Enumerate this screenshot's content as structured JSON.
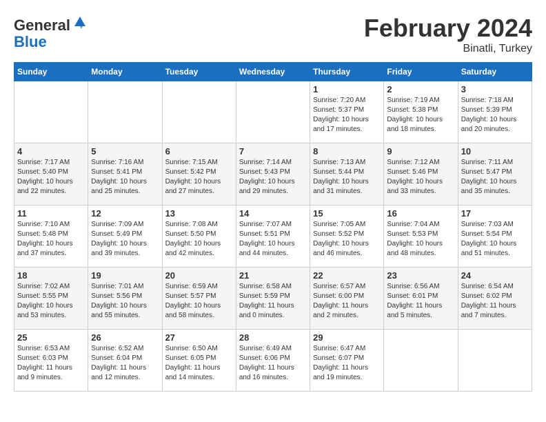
{
  "header": {
    "logo_line1": "General",
    "logo_line2": "Blue",
    "month_title": "February 2024",
    "location": "Binatli, Turkey"
  },
  "columns": [
    "Sunday",
    "Monday",
    "Tuesday",
    "Wednesday",
    "Thursday",
    "Friday",
    "Saturday"
  ],
  "weeks": [
    [
      {
        "day": "",
        "sunrise": "",
        "sunset": "",
        "daylight": ""
      },
      {
        "day": "",
        "sunrise": "",
        "sunset": "",
        "daylight": ""
      },
      {
        "day": "",
        "sunrise": "",
        "sunset": "",
        "daylight": ""
      },
      {
        "day": "",
        "sunrise": "",
        "sunset": "",
        "daylight": ""
      },
      {
        "day": "1",
        "sunrise": "Sunrise: 7:20 AM",
        "sunset": "Sunset: 5:37 PM",
        "daylight": "Daylight: 10 hours and 17 minutes."
      },
      {
        "day": "2",
        "sunrise": "Sunrise: 7:19 AM",
        "sunset": "Sunset: 5:38 PM",
        "daylight": "Daylight: 10 hours and 18 minutes."
      },
      {
        "day": "3",
        "sunrise": "Sunrise: 7:18 AM",
        "sunset": "Sunset: 5:39 PM",
        "daylight": "Daylight: 10 hours and 20 minutes."
      }
    ],
    [
      {
        "day": "4",
        "sunrise": "Sunrise: 7:17 AM",
        "sunset": "Sunset: 5:40 PM",
        "daylight": "Daylight: 10 hours and 22 minutes."
      },
      {
        "day": "5",
        "sunrise": "Sunrise: 7:16 AM",
        "sunset": "Sunset: 5:41 PM",
        "daylight": "Daylight: 10 hours and 25 minutes."
      },
      {
        "day": "6",
        "sunrise": "Sunrise: 7:15 AM",
        "sunset": "Sunset: 5:42 PM",
        "daylight": "Daylight: 10 hours and 27 minutes."
      },
      {
        "day": "7",
        "sunrise": "Sunrise: 7:14 AM",
        "sunset": "Sunset: 5:43 PM",
        "daylight": "Daylight: 10 hours and 29 minutes."
      },
      {
        "day": "8",
        "sunrise": "Sunrise: 7:13 AM",
        "sunset": "Sunset: 5:44 PM",
        "daylight": "Daylight: 10 hours and 31 minutes."
      },
      {
        "day": "9",
        "sunrise": "Sunrise: 7:12 AM",
        "sunset": "Sunset: 5:46 PM",
        "daylight": "Daylight: 10 hours and 33 minutes."
      },
      {
        "day": "10",
        "sunrise": "Sunrise: 7:11 AM",
        "sunset": "Sunset: 5:47 PM",
        "daylight": "Daylight: 10 hours and 35 minutes."
      }
    ],
    [
      {
        "day": "11",
        "sunrise": "Sunrise: 7:10 AM",
        "sunset": "Sunset: 5:48 PM",
        "daylight": "Daylight: 10 hours and 37 minutes."
      },
      {
        "day": "12",
        "sunrise": "Sunrise: 7:09 AM",
        "sunset": "Sunset: 5:49 PM",
        "daylight": "Daylight: 10 hours and 39 minutes."
      },
      {
        "day": "13",
        "sunrise": "Sunrise: 7:08 AM",
        "sunset": "Sunset: 5:50 PM",
        "daylight": "Daylight: 10 hours and 42 minutes."
      },
      {
        "day": "14",
        "sunrise": "Sunrise: 7:07 AM",
        "sunset": "Sunset: 5:51 PM",
        "daylight": "Daylight: 10 hours and 44 minutes."
      },
      {
        "day": "15",
        "sunrise": "Sunrise: 7:05 AM",
        "sunset": "Sunset: 5:52 PM",
        "daylight": "Daylight: 10 hours and 46 minutes."
      },
      {
        "day": "16",
        "sunrise": "Sunrise: 7:04 AM",
        "sunset": "Sunset: 5:53 PM",
        "daylight": "Daylight: 10 hours and 48 minutes."
      },
      {
        "day": "17",
        "sunrise": "Sunrise: 7:03 AM",
        "sunset": "Sunset: 5:54 PM",
        "daylight": "Daylight: 10 hours and 51 minutes."
      }
    ],
    [
      {
        "day": "18",
        "sunrise": "Sunrise: 7:02 AM",
        "sunset": "Sunset: 5:55 PM",
        "daylight": "Daylight: 10 hours and 53 minutes."
      },
      {
        "day": "19",
        "sunrise": "Sunrise: 7:01 AM",
        "sunset": "Sunset: 5:56 PM",
        "daylight": "Daylight: 10 hours and 55 minutes."
      },
      {
        "day": "20",
        "sunrise": "Sunrise: 6:59 AM",
        "sunset": "Sunset: 5:57 PM",
        "daylight": "Daylight: 10 hours and 58 minutes."
      },
      {
        "day": "21",
        "sunrise": "Sunrise: 6:58 AM",
        "sunset": "Sunset: 5:59 PM",
        "daylight": "Daylight: 11 hours and 0 minutes."
      },
      {
        "day": "22",
        "sunrise": "Sunrise: 6:57 AM",
        "sunset": "Sunset: 6:00 PM",
        "daylight": "Daylight: 11 hours and 2 minutes."
      },
      {
        "day": "23",
        "sunrise": "Sunrise: 6:56 AM",
        "sunset": "Sunset: 6:01 PM",
        "daylight": "Daylight: 11 hours and 5 minutes."
      },
      {
        "day": "24",
        "sunrise": "Sunrise: 6:54 AM",
        "sunset": "Sunset: 6:02 PM",
        "daylight": "Daylight: 11 hours and 7 minutes."
      }
    ],
    [
      {
        "day": "25",
        "sunrise": "Sunrise: 6:53 AM",
        "sunset": "Sunset: 6:03 PM",
        "daylight": "Daylight: 11 hours and 9 minutes."
      },
      {
        "day": "26",
        "sunrise": "Sunrise: 6:52 AM",
        "sunset": "Sunset: 6:04 PM",
        "daylight": "Daylight: 11 hours and 12 minutes."
      },
      {
        "day": "27",
        "sunrise": "Sunrise: 6:50 AM",
        "sunset": "Sunset: 6:05 PM",
        "daylight": "Daylight: 11 hours and 14 minutes."
      },
      {
        "day": "28",
        "sunrise": "Sunrise: 6:49 AM",
        "sunset": "Sunset: 6:06 PM",
        "daylight": "Daylight: 11 hours and 16 minutes."
      },
      {
        "day": "29",
        "sunrise": "Sunrise: 6:47 AM",
        "sunset": "Sunset: 6:07 PM",
        "daylight": "Daylight: 11 hours and 19 minutes."
      },
      {
        "day": "",
        "sunrise": "",
        "sunset": "",
        "daylight": ""
      },
      {
        "day": "",
        "sunrise": "",
        "sunset": "",
        "daylight": ""
      }
    ]
  ]
}
